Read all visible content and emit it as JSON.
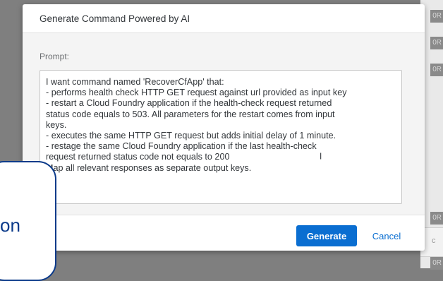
{
  "background": {
    "right_tabs": [
      "0R",
      "0R",
      "0R",
      "0R",
      "0R"
    ],
    "bottom_bar_icon": "c"
  },
  "dialog": {
    "title": "Generate Command Powered by AI",
    "prompt_label": "Prompt:",
    "prompt_lines": [
      "I want command named 'RecoverCfApp' that:",
      "- performs health check HTTP GET request against url provided as input key",
      "- restart a Cloud Foundry application if the health-check request returned",
      "status code equals to 503. All parameters for the restart comes from input",
      "keys.",
      "- executes the same HTTP GET request but adds initial delay of 1 minute.",
      "- restage the same Cloud Foundry application if the last health-check",
      "request returned status code not equals to 200",
      "Map all relevant responses as separate output keys."
    ],
    "generate_label": "Generate",
    "cancel_label": "Cancel"
  },
  "callout": {
    "text": "on"
  },
  "colors": {
    "primary": "#0a6ed1",
    "callout_border": "#0b3a8a",
    "overlay": "#7f7f7f"
  }
}
